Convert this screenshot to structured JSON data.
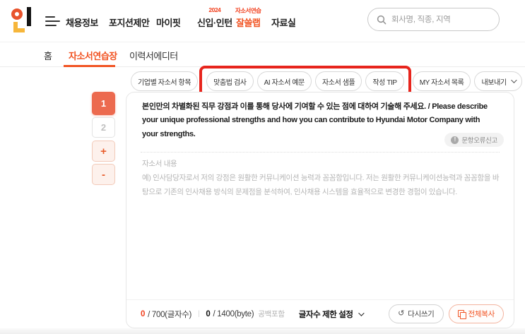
{
  "colors": {
    "accent": "#f15322",
    "active_page_bg": "#ec6a4f",
    "annotation_red": "#e7251d",
    "logo_circle": "#e8532c",
    "logo_yellow": "#f6b63b"
  },
  "header": {
    "nav": [
      {
        "label": "채용정보"
      },
      {
        "label": "포지션제안"
      },
      {
        "label": "마이핏"
      },
      {
        "label": "신입·인턴",
        "badge": "2024"
      },
      {
        "label": "잘쓸랩",
        "badge": "자소서연습"
      },
      {
        "label": "자료실"
      }
    ],
    "search": {
      "placeholder": "회사명, 직종, 지역"
    }
  },
  "subnav": {
    "active": "자소서연습장",
    "items": [
      {
        "label": "홈"
      },
      {
        "label": "자소서연습장"
      },
      {
        "label": "이력서에디터"
      }
    ]
  },
  "toolbar": {
    "pills": [
      {
        "label": "기업별 자소서 항목"
      },
      {
        "label": "맞춤법 검사",
        "highlighted": true
      },
      {
        "label": "AI 자소서 예문",
        "highlighted": true
      },
      {
        "label": "자소서 샘플",
        "highlighted": true
      },
      {
        "label": "작성 TIP",
        "highlighted": true
      },
      {
        "label": "MY 자소서 목록"
      },
      {
        "label": "내보내기",
        "has_dropdown": true
      }
    ]
  },
  "pager": {
    "active_page": "1",
    "pages": [
      "1",
      "2"
    ],
    "add_label": "+",
    "remove_label": "-"
  },
  "editor": {
    "question": "본인만의 차별화된 직무 강점과 이를 통해 당사에 기여할 수 있는 점에 대하여 기술해 주세요. / Please describe your unique professional strengths and how you can contribute to Hyundai Motor Company with your strengths.",
    "report_button": "문항오류신고",
    "content_label": "자소서 내용",
    "content_placeholder": "예) 인사담당자로서 저의 강점은 원활한 커뮤니케이션 능력과 꼼꼼함입니다. 저는 원활한 커뮤니케이션능력과 꼼꼼함을 바탕으로 기존의 인사채용 방식의 문제점을 분석하여, 인사채용 시스템을 효율적으로 변경한 경험이 있습니다.",
    "counter": {
      "char_current": "0",
      "char_limit": "/ 700(글자수)",
      "divider": "|",
      "byte_current": "0",
      "byte_limit": "/ 1400(byte)",
      "spaces_note": "공백포함",
      "limit_setting": "글자수 제한 설정"
    },
    "rewrite_button": "다시쓰기",
    "copy_all_button": "전체복사"
  },
  "icons": {
    "refresh": "↺",
    "info_mark": "!"
  }
}
